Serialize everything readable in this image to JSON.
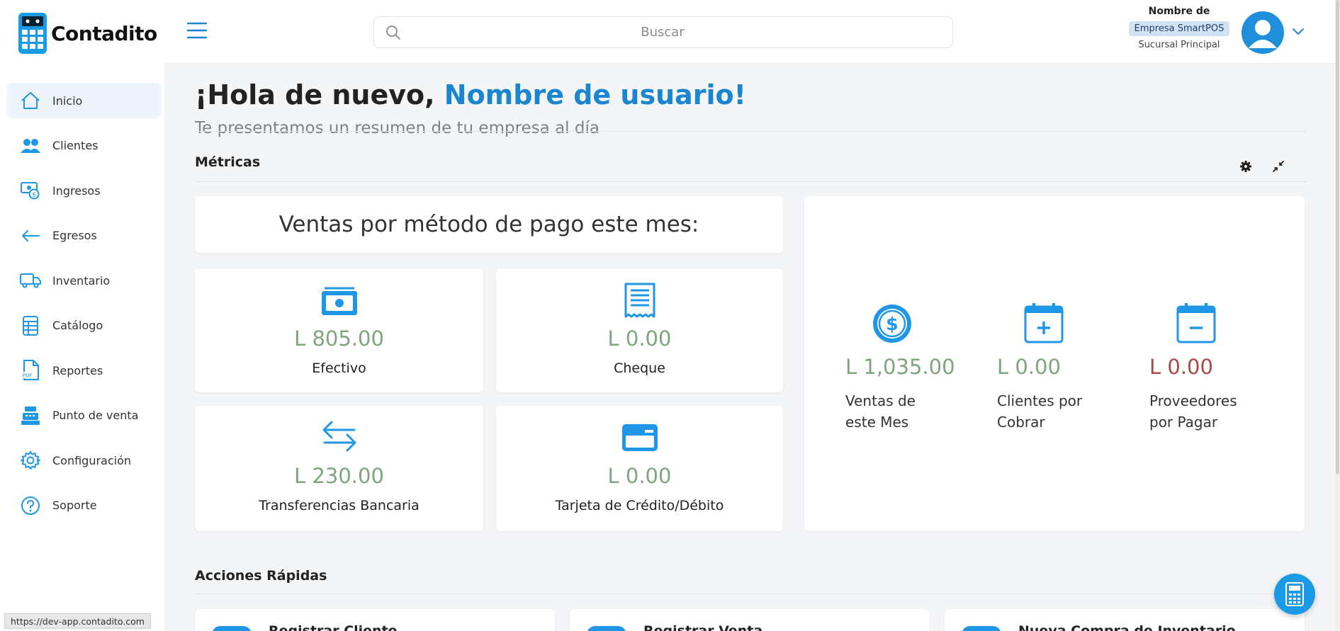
{
  "app": {
    "name": "Contadito"
  },
  "sidebar": {
    "items": [
      {
        "label": "Inicio",
        "icon": "home-icon",
        "active": true
      },
      {
        "label": "Clientes",
        "icon": "users-icon"
      },
      {
        "label": "Ingresos",
        "icon": "income-icon"
      },
      {
        "label": "Egresos",
        "icon": "arrow-left-icon"
      },
      {
        "label": "Inventario",
        "icon": "truck-icon"
      },
      {
        "label": "Catálogo",
        "icon": "catalog-icon"
      },
      {
        "label": "Reportes",
        "icon": "pdf-icon"
      },
      {
        "label": "Punto de venta",
        "icon": "cash-register-icon"
      },
      {
        "label": "Configuración",
        "icon": "gear-icon"
      },
      {
        "label": "Soporte",
        "icon": "help-icon"
      }
    ]
  },
  "header": {
    "search_placeholder": "Buscar",
    "company_name_line": "Nombre de",
    "company_badge": "Empresa SmartPOS",
    "branch": "Sucursal Principal"
  },
  "main": {
    "greeting_prefix": "¡Hola de nuevo, ",
    "greeting_name": "Nombre de usuario!",
    "subtitle": "Te presentamos un resumen de tu empresa al día",
    "metrics_title": "Métricas",
    "payments_title": "Ventas por método de pago este mes:",
    "payments": [
      {
        "amount": "L 805.00",
        "label": "Efectivo",
        "icon": "banknote-icon"
      },
      {
        "amount": "L 0.00",
        "label": "Cheque",
        "icon": "receipt-icon"
      },
      {
        "amount": "L 230.00",
        "label": "Transferencias Bancaria",
        "icon": "transfer-icon"
      },
      {
        "amount": "L 0.00",
        "label": "Tarjeta de Crédito/Débito",
        "icon": "credit-card-icon"
      }
    ],
    "summary": [
      {
        "amount": "L 1,035.00",
        "label_line1": "Ventas de",
        "label_line2": "este Mes",
        "icon": "dollar-coin-icon"
      },
      {
        "amount": "L 0.00",
        "label_line1": "Clientes por",
        "label_line2": "Cobrar",
        "icon": "calendar-plus-icon"
      },
      {
        "amount": "L 0.00",
        "label_line1": "Proveedores",
        "label_line2": "por Pagar",
        "icon": "calendar-minus-icon"
      }
    ],
    "quick_actions_title": "Acciones Rápidas",
    "quick_actions": [
      {
        "label": "Registrar Cliente"
      },
      {
        "label": "Registrar Venta"
      },
      {
        "label": "Nueva Compra de Inventario"
      }
    ]
  },
  "status_bar": {
    "url": "https://dev-app.contadito.com"
  },
  "colors": {
    "accent": "#1b86cf",
    "positive": "#7fa57f",
    "negative": "#a94a4a",
    "icon_blue": "#1f97e6"
  }
}
